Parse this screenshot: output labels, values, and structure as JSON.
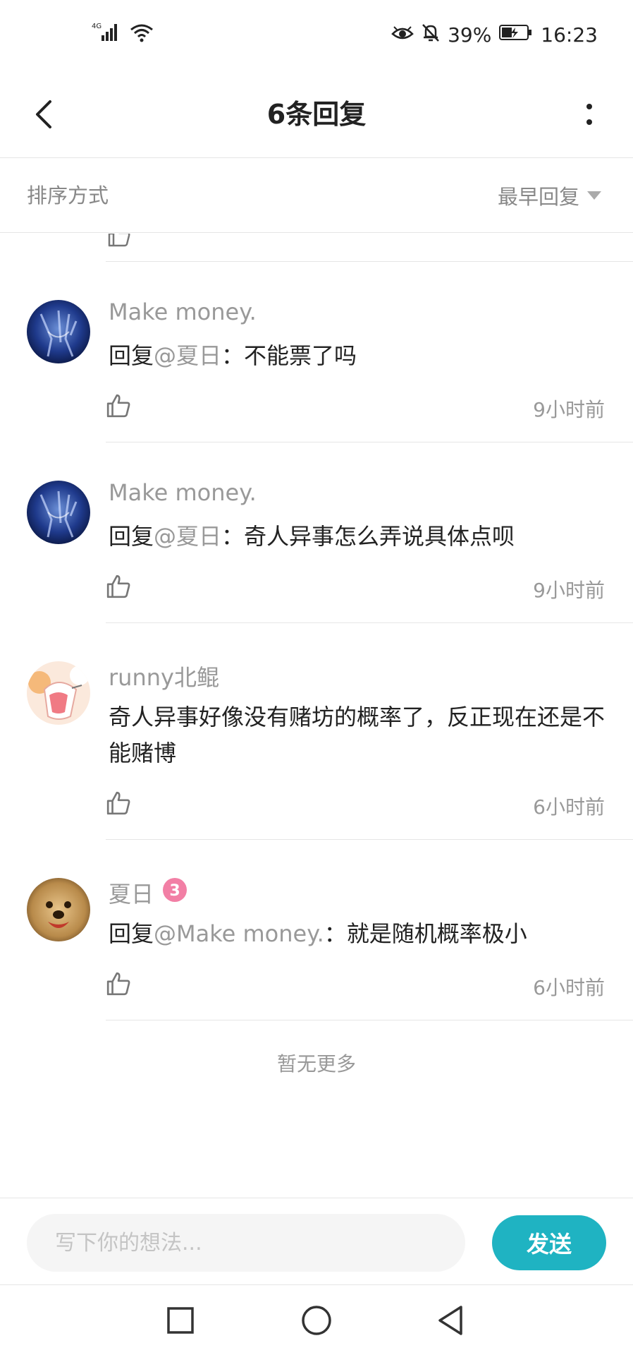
{
  "status_bar": {
    "network": "4G",
    "battery": "39%",
    "time": "16:23",
    "icons": [
      "signal-icon",
      "wifi-icon",
      "eye-icon",
      "bell-off-icon",
      "battery-icon"
    ]
  },
  "header": {
    "title": "6条回复",
    "back_icon": "chevron-left-icon",
    "more_icon": "more-vertical-icon"
  },
  "sort": {
    "label": "排序方式",
    "selected": "最早回复"
  },
  "comments": [
    {
      "author": "Make money.",
      "reply_prefix": "回复",
      "mention": "@夏日",
      "body": "：不能票了吗",
      "time": "9小时前"
    },
    {
      "author": "Make money.",
      "reply_prefix": "回复",
      "mention": "@夏日",
      "body": "：奇人异事怎么弄说具体点呗",
      "time": "9小时前"
    },
    {
      "author": "runny北鲲",
      "body": "奇人异事好像没有赌坊的概率了，反正现在还是不能赌博",
      "time": "6小时前"
    },
    {
      "author": "夏日",
      "badge": "3",
      "reply_prefix": "回复",
      "mention": "@Make money.",
      "body": "：就是随机概率极小",
      "time": "6小时前"
    }
  ],
  "end_text": "暂无更多",
  "input": {
    "placeholder": "写下你的想法..."
  },
  "send_label": "发送",
  "colors": {
    "accent": "#1fb3c2",
    "muted": "#999999",
    "divider": "#e6e6e6"
  }
}
